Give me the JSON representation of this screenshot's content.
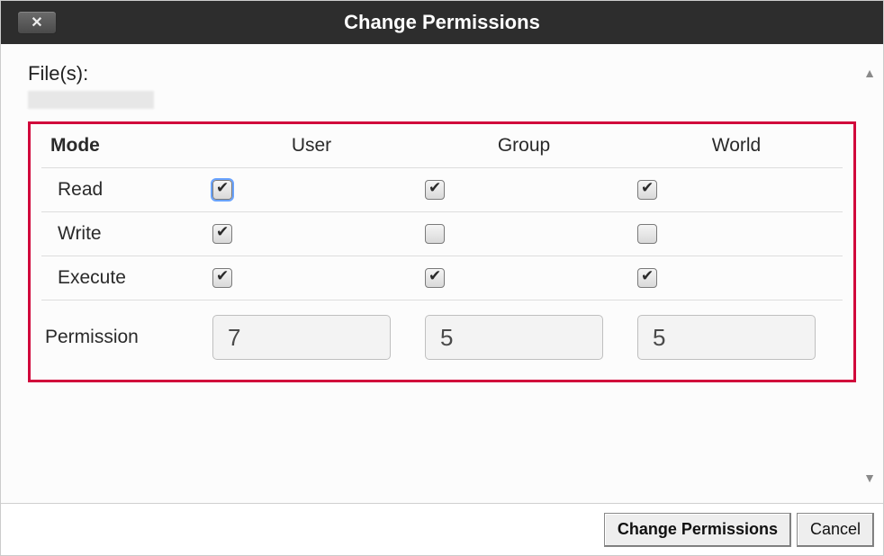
{
  "title": "Change Permissions",
  "files_label": "File(s):",
  "columns": {
    "mode": "Mode",
    "user": "User",
    "group": "Group",
    "world": "World"
  },
  "rows": {
    "read": {
      "label": "Read",
      "user": true,
      "group": true,
      "world": true
    },
    "write": {
      "label": "Write",
      "user": true,
      "group": false,
      "world": false
    },
    "execute": {
      "label": "Execute",
      "user": true,
      "group": true,
      "world": true
    }
  },
  "permission_label": "Permission",
  "permission": {
    "user": "7",
    "group": "5",
    "world": "5"
  },
  "buttons": {
    "change": "Change Permissions",
    "cancel": "Cancel"
  },
  "focused_checkbox": "read.user"
}
